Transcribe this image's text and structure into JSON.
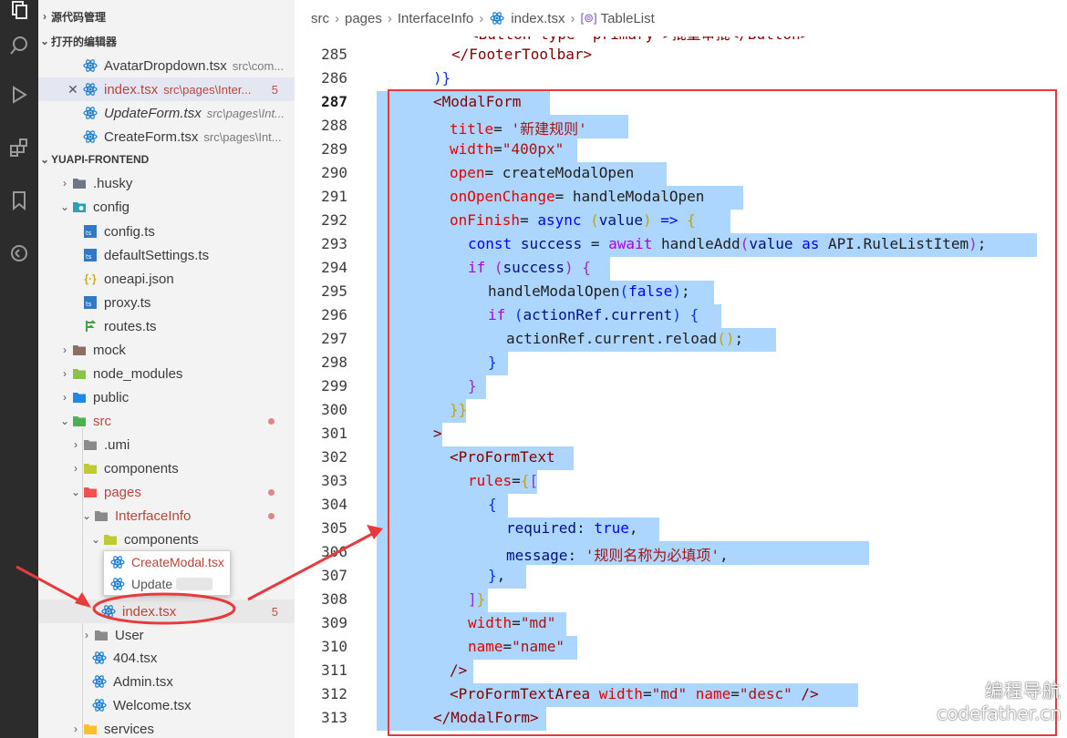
{
  "colors": {
    "accent_red": "#e8393c",
    "selection": "#add6ff",
    "activity_bar": "#2c2c2c",
    "sidebar_bg": "#f3f3f3"
  },
  "activity_bar": {
    "icons": [
      "explorer-icon",
      "search-icon",
      "run-debug-icon",
      "extensions-icon",
      "bookmark-icon",
      "remote-icon"
    ]
  },
  "sidebar": {
    "source_control": "源代码管理",
    "open_editors": "打开的编辑器",
    "open_files": [
      {
        "name": "AvatarDropdown.tsx",
        "path": "src\\com..."
      },
      {
        "name": "index.tsx",
        "path": "src\\pages\\Inter...",
        "badge": "5"
      },
      {
        "name": "UpdateForm.tsx",
        "path": "src\\pages\\Int..."
      },
      {
        "name": "CreateForm.tsx",
        "path": "src\\pages\\Int..."
      }
    ],
    "project": "YUAPI-FRONTEND",
    "tree": {
      "husky": ".husky",
      "config": "config",
      "config_ts": "config.ts",
      "default_settings": "defaultSettings.ts",
      "oneapi": "oneapi.json",
      "proxy": "proxy.ts",
      "routes": "routes.ts",
      "mock": "mock",
      "node_modules": "node_modules",
      "public": "public",
      "src": "src",
      "umi": ".umi",
      "components": "components",
      "pages": "pages",
      "interface_info": "InterfaceInfo",
      "ii_components": "components",
      "create_modal": "CreateModal.tsx",
      "update_partial": "Update",
      "index": "index.tsx",
      "index_badge": "5",
      "user": "User",
      "f404": "404.tsx",
      "admin": "Admin.tsx",
      "welcome": "Welcome.tsx",
      "services": "services"
    }
  },
  "breadcrumb": {
    "items": [
      "src",
      "pages",
      "InterfaceInfo",
      "index.tsx",
      "TableList"
    ]
  },
  "editor": {
    "top_partial": "<Button type=\"primary\">批量审批</Button>",
    "line_numbers": [
      "285",
      "286",
      "287",
      "288",
      "289",
      "290",
      "291",
      "292",
      "293",
      "294",
      "295",
      "296",
      "297",
      "298",
      "299",
      "300",
      "301",
      "302",
      "303",
      "304",
      "305",
      "306",
      "307",
      "308",
      "309",
      "310",
      "311",
      "312",
      "313"
    ],
    "current_line": "287",
    "code": {
      "l285": "</FooterToolbar>",
      "l286": ")}",
      "l287": "<ModalForm",
      "l288_attr": "title",
      "l288_val": "'新建规则'",
      "l289_attr": "width",
      "l289_val": "\"400px\"",
      "l290_attr": "open",
      "l290_val": "createModalOpen",
      "l291_attr": "onOpenChange",
      "l291_val": "handleModalOpen",
      "l292_attr": "onFinish",
      "l292_kw": "async",
      "l292_arg": "value",
      "l293_kw": "const",
      "l293_var": "success",
      "l293_await": "await",
      "l293_fn": "handleAdd",
      "l293_arg": "value",
      "l293_as": "as",
      "l293_type": "API.RuleListItem",
      "l294_kw": "if",
      "l294_var": "success",
      "l295_fn": "handleModalOpen",
      "l295_val": "false",
      "l296_kw": "if",
      "l296_var": "actionRef.current",
      "l297_call": "actionRef.current.reload",
      "l302_tag": "<ProFormText",
      "l303_attr": "rules",
      "l305_key": "required",
      "l305_val": "true",
      "l306_key": "message",
      "l306_val": "'规则名称为必填项'",
      "l309_attr": "width",
      "l309_val": "\"md\"",
      "l310_attr": "name",
      "l310_val": "\"name\"",
      "l311": "/>",
      "l312_tag": "<ProFormTextArea",
      "l312_a1": "width",
      "l312_v1": "\"md\"",
      "l312_a2": "name",
      "l312_v2": "\"desc\"",
      "l313": "</ModalForm>"
    }
  },
  "watermark": {
    "line1": "编程导航",
    "line2": "codefather.cn"
  }
}
